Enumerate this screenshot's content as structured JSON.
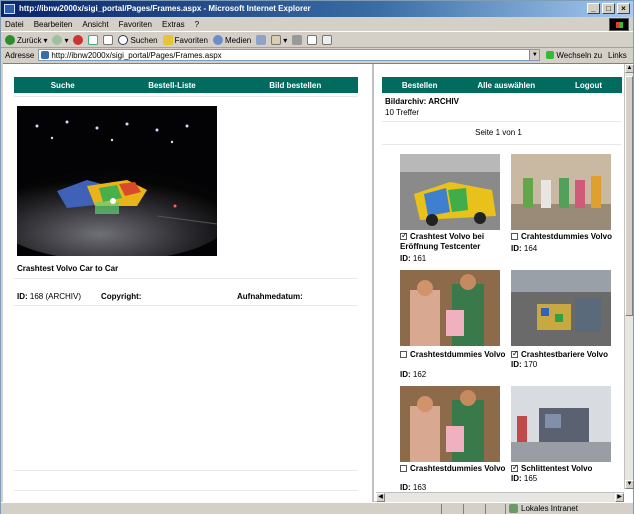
{
  "window": {
    "title": "http://ibnw2000x/sigi_portal/Pages/Frames.aspx - Microsoft Internet Explorer"
  },
  "menu": [
    "Datei",
    "Bearbeiten",
    "Ansicht",
    "Favoriten",
    "Extras",
    "?"
  ],
  "toolbar": {
    "back": "Zurück",
    "search": "Suchen",
    "favorites": "Favoriten",
    "media": "Medien"
  },
  "address": {
    "label": "Adresse",
    "url": "http://ibnw2000x/sigi_portal/Pages/Frames.aspx",
    "go": "Wechseln zu",
    "links": "Links"
  },
  "left": {
    "nav": [
      "Suche",
      "Bestell-Liste",
      "Bild bestellen"
    ],
    "caption": "Crashtest Volvo Car to Car",
    "meta": {
      "id_label": "ID:",
      "id_value": "168 (ARCHIV)",
      "copyright": "Copyright:",
      "date": "Aufnahmedatum:"
    }
  },
  "right": {
    "nav": [
      "Bestellen",
      "Alle auswählen",
      "Logout"
    ],
    "archive": "Bildarchiv: ARCHIV",
    "hits": "10 Treffer",
    "page": "Seite 1 von 1",
    "items": [
      {
        "label": "Crashtest Volvo bei Eröffnung Testcenter",
        "id": "161",
        "checked": true
      },
      {
        "label": "Crahtestdummies Volvo",
        "id": "164",
        "checked": false
      },
      {
        "label": "Crashtestdummies Volvo",
        "id": "162",
        "checked": false
      },
      {
        "label": "Crashtestbariere Volvo",
        "id": "170",
        "checked": true
      },
      {
        "label": "Crashtestdummies Volvo",
        "id": "163",
        "checked": false
      },
      {
        "label": "Schlittentest Volvo",
        "id": "165",
        "checked": true
      }
    ],
    "id_label": "ID:"
  },
  "status": {
    "zone": "Lokales Intranet"
  }
}
